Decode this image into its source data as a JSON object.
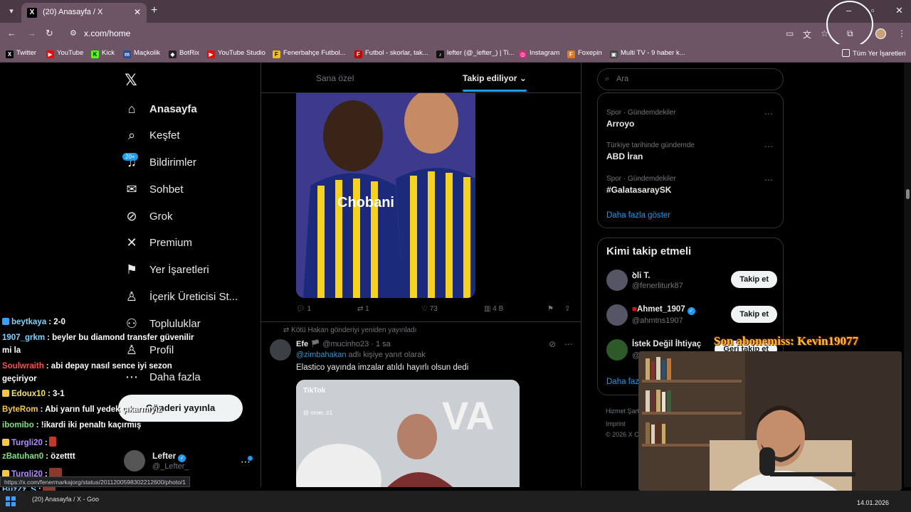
{
  "browser": {
    "tab_title": "(20) Anasayfa / X",
    "tab_favicon": "X",
    "url": "x.com/home",
    "bookmarks": [
      {
        "label": "Twitter",
        "icon": "x-icon",
        "color": "#000000"
      },
      {
        "label": "YouTube",
        "icon": "youtube-icon",
        "color": "#ff0000"
      },
      {
        "label": "Kick",
        "icon": "kick-icon",
        "color": "#53fc18"
      },
      {
        "label": "Maçkolik",
        "icon": "mackolik-icon",
        "color": "#1f4ea3"
      },
      {
        "label": "BotRix",
        "icon": "botrix-icon",
        "color": "#222222"
      },
      {
        "label": "YouTube Studio",
        "icon": "youtube-studio-icon",
        "color": "#ff0000"
      },
      {
        "label": "Fenerbahçe Futbol...",
        "icon": "fenerbahce-icon",
        "color": "#f4c300"
      },
      {
        "label": "Futbol - skorlar, tak...",
        "icon": "flashscore-icon",
        "color": "#c40000"
      },
      {
        "label": "lefter (@_lefter_) | Ti...",
        "icon": "tiktok-icon",
        "color": "#111111"
      },
      {
        "label": "Instagram",
        "icon": "instagram-icon",
        "color": "#d6287a"
      },
      {
        "label": "Foxepin",
        "icon": "foxepin-icon",
        "color": "#e07a1f"
      },
      {
        "label": "Multi TV - 9 haber k...",
        "icon": "multitv-icon",
        "color": "#444444"
      }
    ],
    "all_bookmarks": "Tüm Yer İşaretleri"
  },
  "sidebar": {
    "badge": "20+",
    "items": [
      {
        "label": "Anasayfa",
        "icon": "home-icon"
      },
      {
        "label": "Keşfet",
        "icon": "search-icon"
      },
      {
        "label": "Bildirimler",
        "icon": "bell-icon"
      },
      {
        "label": "Sohbet",
        "icon": "mail-icon"
      },
      {
        "label": "Grok",
        "icon": "grok-icon"
      },
      {
        "label": "Premium",
        "icon": "x-icon"
      },
      {
        "label": "Yer İşaretleri",
        "icon": "bookmark-icon"
      },
      {
        "label": "İçerik Üreticisi St...",
        "icon": "creator-icon"
      },
      {
        "label": "Topluluklar",
        "icon": "communities-icon"
      },
      {
        "label": "Profil",
        "icon": "profile-icon"
      },
      {
        "label": "Daha fazla",
        "icon": "more-icon"
      }
    ],
    "post_button": "Gönderi yayınla",
    "account": {
      "name": "Lefter",
      "handle": "@_Lefter_"
    }
  },
  "timeline": {
    "tabs": [
      "Sana özel",
      "Takip ediliyor"
    ],
    "post1": {
      "image_text": "Chobani",
      "replies": "1",
      "reposts": "1",
      "likes": "73",
      "views": "4 B"
    },
    "post2": {
      "repost_note": "Kötü Hakan gönderiyi yeniden yayınladı",
      "author": "Efe",
      "handle": "@mucinho23",
      "time": "· 1 sa",
      "reply_to_prefix": "@zimbahakan",
      "reply_to_suffix": " adlı kişiye yanıt olarak",
      "text": "Elastico yayında imzalar atıldı hayırlı olsun dedi",
      "media_label": "TikTok",
      "media_sub": "@ omer..z1",
      "media_overlay": "VA"
    }
  },
  "right": {
    "search_placeholder": "Ara",
    "trends": [
      {
        "context": "Spor · Gündemdekiler",
        "name": "Arroyo"
      },
      {
        "context": "Türkiye tarihinde gündemde",
        "name": "ABD İran"
      },
      {
        "context": "Spor · Gündemdekiler",
        "name": "#GalatasaraySK"
      }
    ],
    "show_more": "Daha fazla göster",
    "who_to_follow": {
      "title": "Kimi takip etmeli",
      "users": [
        {
          "name": "ꝺli T.",
          "handle": "@fenerliturk87",
          "button": "Takip et"
        },
        {
          "name": "Ahmet_1907",
          "handle": "@ahmtns1907",
          "button": "Takip et"
        },
        {
          "name": "İstek Değil İhtiyaç",
          "handle": "@ta",
          "button": "Geri takip et"
        }
      ],
      "more": "Daha faz"
    },
    "footer": [
      "Hizmet Şart",
      "Imprint",
      "© 2026 X C"
    ]
  },
  "overlay": {
    "chat": [
      {
        "user": "beytkaya",
        "color": "#7fd3ff",
        "msg": ": 2-0"
      },
      {
        "user": "1907_grkm",
        "color": "#7fd3ff",
        "msg": ": beyler bu diamond transfer güvenilir",
        "cont": "mi la"
      },
      {
        "user": "Soulwraith",
        "color": "#ff4d4d",
        "msg": ": abi depay nasıl sence iyi sezon",
        "cont": "geçiriyor"
      },
      {
        "user": "Edoux10",
        "color": "#f5e663",
        "msg": ": 3-1"
      },
      {
        "user": "ByteRom",
        "color": "#f5c84a",
        "msg": ": Abi yarın full yedek çıkarmıyız"
      },
      {
        "user": "ibomibo",
        "color": "#7fe07f",
        "msg": ": !ikardi iki penaltı kaçırmış"
      },
      {
        "user": "Turgli20",
        "color": "#b58cff",
        "msg": ":"
      },
      {
        "user": "zBatuhan0",
        "color": "#7fe07f",
        "msg": ": özetttt"
      },
      {
        "user": "Turgli20",
        "color": "#b58cff",
        "msg": ":"
      },
      {
        "user": "BuzZz_S",
        "color": "#7fd3ff",
        "msg": ":"
      },
      {
        "user": "emrecakir59",
        "color": "#f5e663",
        "msg": ":"
      }
    ],
    "sub_alert": "Son abonemiss: Kevin19077"
  },
  "status_url": "https://x.com/fenermarkajorg/status/2011200598302212600/photo/1",
  "taskbar": {
    "item": "(20) Anasayfa / X - Goo",
    "date": "14.01.2026"
  }
}
